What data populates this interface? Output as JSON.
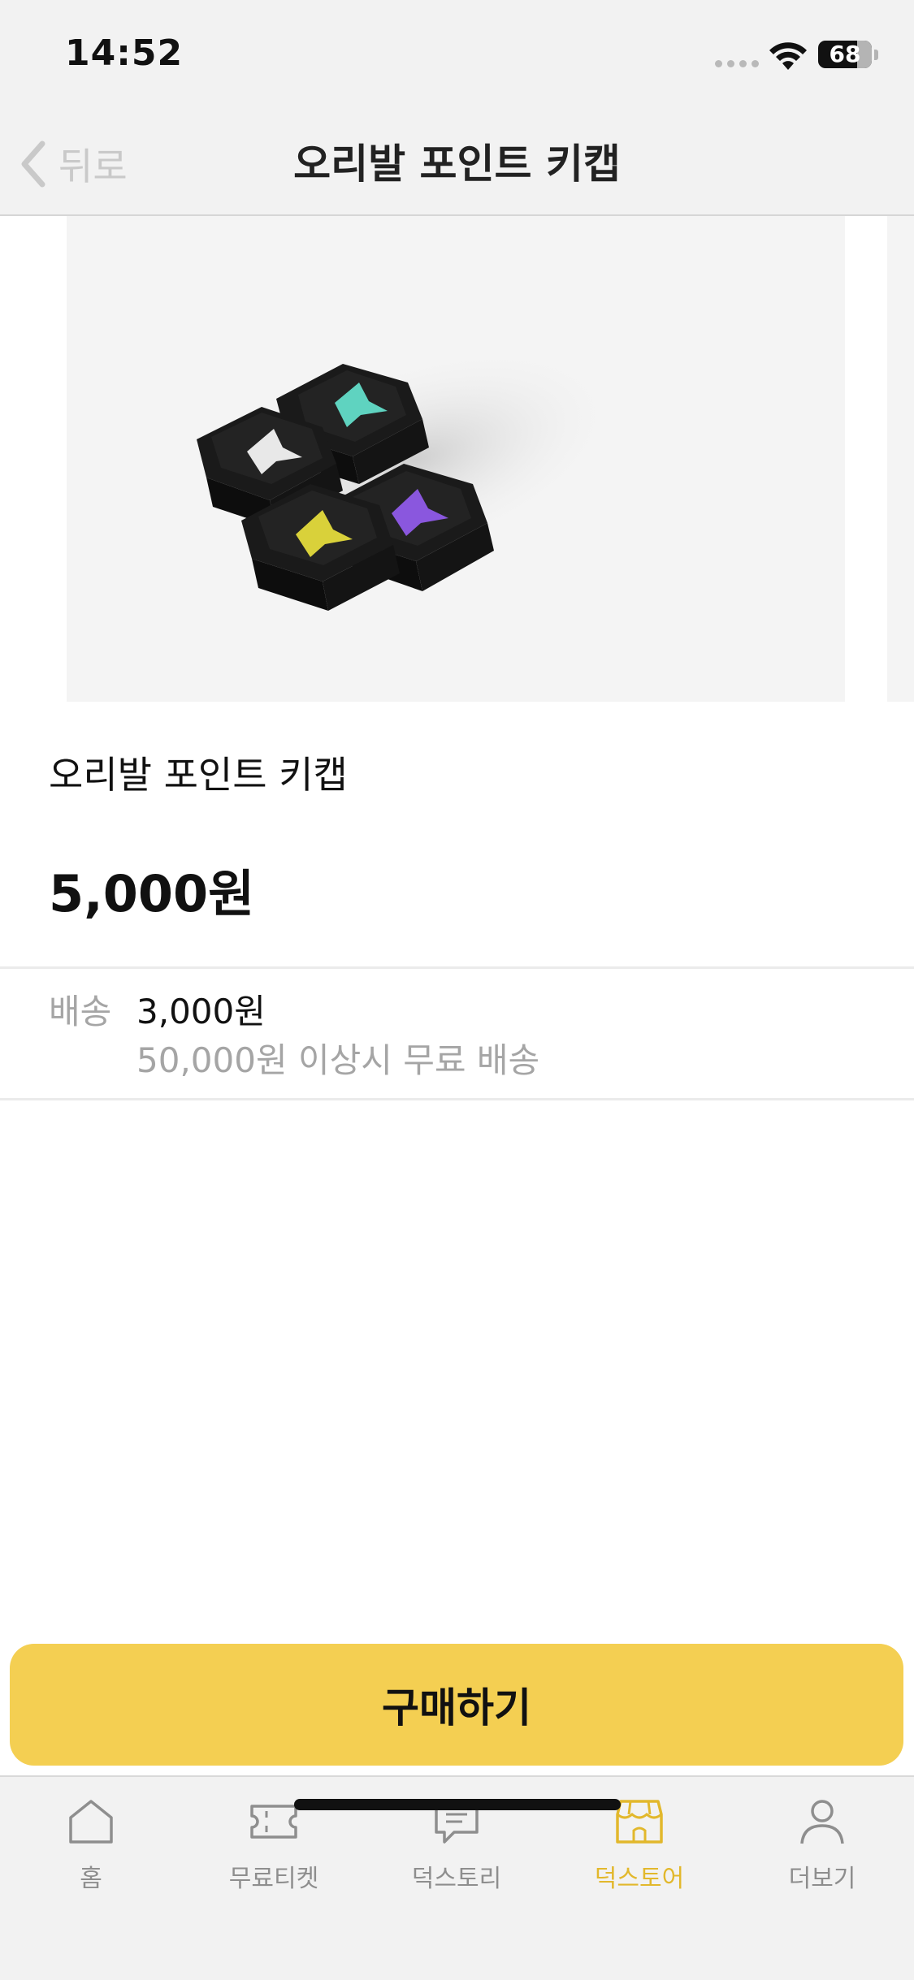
{
  "status_bar": {
    "time": "14:52",
    "battery": "68"
  },
  "nav": {
    "back_label": "뒤로",
    "title": "오리발 포인트 키캡"
  },
  "product": {
    "name": "오리발 포인트 키캡",
    "price": "5,000원",
    "keycap_accents": [
      "#e8e8e8",
      "#5fd3c0",
      "#d9d13a",
      "#8a57de"
    ]
  },
  "shipping": {
    "label": "배송",
    "fee": "3,000원",
    "note": "50,000원 이상시 무료 배송"
  },
  "buy_button": {
    "label": "구매하기"
  },
  "tabs": [
    {
      "label": "홈",
      "icon": "home-icon",
      "active": false
    },
    {
      "label": "무료티켓",
      "icon": "ticket-icon",
      "active": false
    },
    {
      "label": "덕스토리",
      "icon": "chat-icon",
      "active": false
    },
    {
      "label": "덕스토어",
      "icon": "store-icon",
      "active": true
    },
    {
      "label": "더보기",
      "icon": "person-icon",
      "active": false
    }
  ],
  "colors": {
    "accent": "#f4cf52",
    "active_tab": "#e2b82c"
  }
}
